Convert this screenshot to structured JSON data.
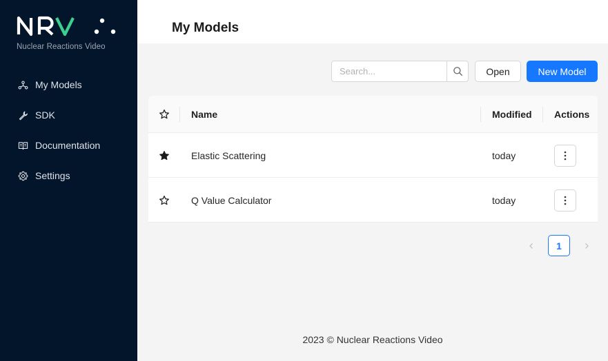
{
  "brand": {
    "logo_text": "NRV",
    "tagline": "Nuclear Reactions Video",
    "accent_color": "#3ecf8e"
  },
  "sidebar": {
    "items": [
      {
        "label": "My Models",
        "icon": "models-icon"
      },
      {
        "label": "SDK",
        "icon": "wrench-icon"
      },
      {
        "label": "Documentation",
        "icon": "book-icon"
      },
      {
        "label": "Settings",
        "icon": "gear-icon"
      }
    ]
  },
  "header": {
    "title": "My Models"
  },
  "toolbar": {
    "search_placeholder": "Search...",
    "search_value": "",
    "open_label": "Open",
    "new_model_label": "New Model"
  },
  "table": {
    "columns": {
      "star": "star-icon",
      "name": "Name",
      "modified": "Modified",
      "actions": "Actions"
    },
    "rows": [
      {
        "starred": true,
        "name": "Elastic Scattering",
        "modified": "today"
      },
      {
        "starred": false,
        "name": "Q Value Calculator",
        "modified": "today"
      }
    ]
  },
  "pagination": {
    "current_page": "1"
  },
  "footer": {
    "text": "2023 © Nuclear Reactions Video"
  },
  "colors": {
    "sidebar_bg": "#03152a",
    "primary": "#1677ff"
  }
}
